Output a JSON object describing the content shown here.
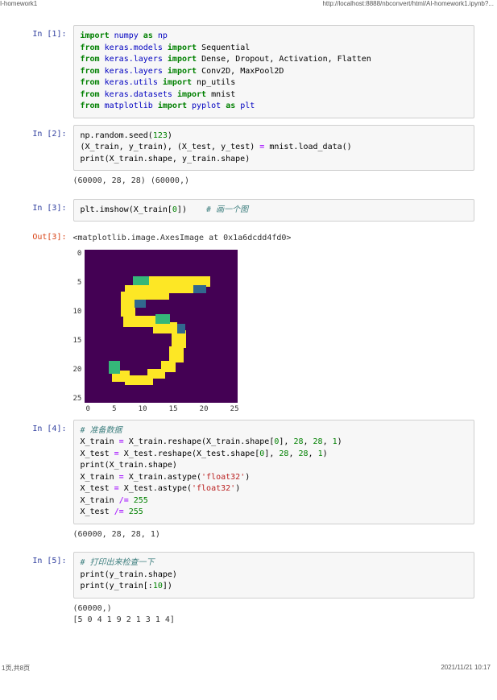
{
  "header": {
    "left": "I-homework1",
    "right": "http://localhost:8888/nbconvert/html/AI-homework1.ipynb?..."
  },
  "footer": {
    "left": "1页,共8页",
    "right": "2021/11/21 10:17"
  },
  "prompts": {
    "in1": "In [1]:",
    "in2": "In [2]:",
    "in3": "In [3]:",
    "out3": "Out[3]:",
    "in4": "In [4]:",
    "in5": "In [5]:"
  },
  "cell1": {
    "kw_import1": "import",
    "np_mod": "numpy",
    "kw_as1": "as",
    "np_alias": "np",
    "kw_from1": "from",
    "mod1": "keras.models",
    "kw_import2": "import",
    "names1": "Sequential",
    "kw_from2": "from",
    "mod2": "keras.layers",
    "kw_import3": "import",
    "names2": "Dense, Dropout, Activation, Flatten",
    "kw_from3": "from",
    "mod3": "keras.layers",
    "kw_import4": "import",
    "names3": "Conv2D, MaxPool2D",
    "kw_from4": "from",
    "mod4": "keras.utils",
    "kw_import5": "import",
    "names4": "np_utils",
    "kw_from5": "from",
    "mod5": "keras.datasets",
    "kw_import6": "import",
    "names5": "mnist",
    "kw_from6": "from",
    "mod6": "matplotlib",
    "kw_import7": "import",
    "names6": "pyplot",
    "kw_as2": "as",
    "plt_alias": "plt"
  },
  "cell2": {
    "l1a": "np.random.seed(",
    "l1n": "123",
    "l1b": ")",
    "l2a": "(X_train, y_train), (X_test, y_test) ",
    "l2op": "=",
    "l2b": " mnist.load_data()",
    "l3a": "print",
    "l3b": "(X_train.shape, y_train.shape)",
    "out": "(60000, 28, 28) (60000,)"
  },
  "cell3": {
    "l1a": "plt.imshow(X_train[",
    "l1n": "0",
    "l1b": "])    ",
    "l1c": "# 画一个图",
    "out_txt": "<matplotlib.image.AxesImage at 0x1a6dcdd4fd0>",
    "yticks": [
      "0",
      "5",
      "10",
      "15",
      "20",
      "25"
    ],
    "xticks": [
      "0",
      "5",
      "10",
      "15",
      "20",
      "25"
    ]
  },
  "cell4": {
    "c1": "# 准备数据",
    "l2a": "X_train ",
    "l2op": "=",
    "l2b": " X_train.reshape(X_train.shape[",
    "l2n0": "0",
    "l2c": "], ",
    "l2n1": "28",
    "l2d": ", ",
    "l2n2": "28",
    "l2e": ", ",
    "l2n3": "1",
    "l2f": ")",
    "l3a": "X_test ",
    "l3op": "=",
    "l3b": " X_test.reshape(X_test.shape[",
    "l3n0": "0",
    "l3c": "], ",
    "l3n1": "28",
    "l3d": ", ",
    "l3n2": "28",
    "l3e": ", ",
    "l3n3": "1",
    "l3f": ")",
    "l4a": "print",
    "l4b": "(X_train.shape)",
    "l5a": "X_train ",
    "l5op": "=",
    "l5b": " X_train.astype(",
    "l5s": "'float32'",
    "l5c": ")",
    "l6a": "X_test ",
    "l6op": "=",
    "l6b": " X_test.astype(",
    "l6s": "'float32'",
    "l6c": ")",
    "l7a": "X_train ",
    "l7op": "/=",
    "l7n": " 255",
    "l8a": "X_test ",
    "l8op": "/=",
    "l8n": " 255",
    "out": "(60000, 28, 28, 1)"
  },
  "cell5": {
    "c1": "# 打印出来检查一下",
    "l2a": "print",
    "l2b": "(y_train.shape)",
    "l3a": "print",
    "l3b": "(y_train[:",
    "l3n": "10",
    "l3c": "])",
    "out": "(60000,)\n[5 0 4 1 9 2 1 3 1 4]"
  },
  "chart_data": {
    "type": "heatmap",
    "title": "",
    "xlabel": "",
    "ylabel": "",
    "xlim": [
      0,
      27
    ],
    "ylim": [
      0,
      27
    ],
    "xticks": [
      0,
      5,
      10,
      15,
      20,
      25
    ],
    "yticks": [
      0,
      5,
      10,
      15,
      20,
      25
    ],
    "colormap": "viridis",
    "description": "MNIST training image index 0, a handwritten digit 5, 28×28 grayscale, displayed with matplotlib imshow default viridis colormap (dark purple background, yellow-green strokes)."
  }
}
